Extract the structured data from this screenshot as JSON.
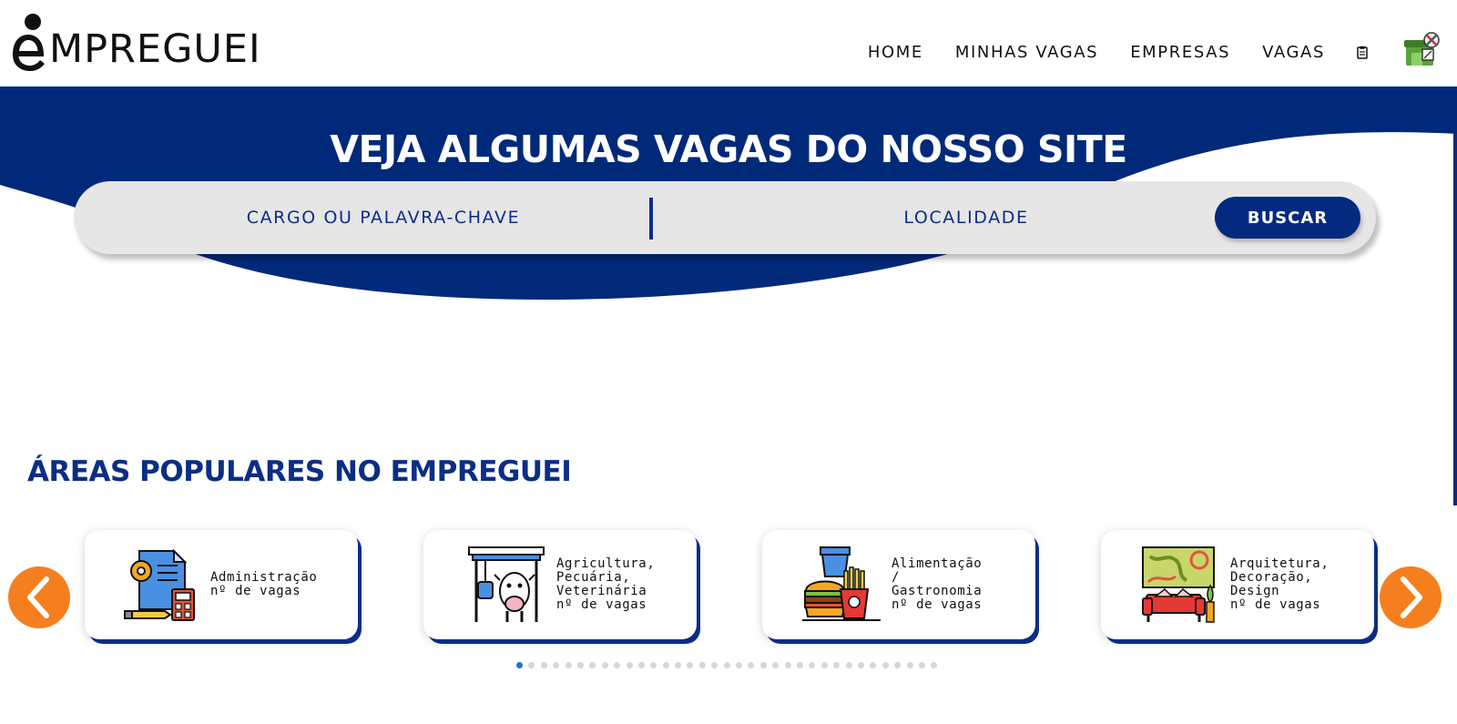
{
  "brand": {
    "logo_text": "MPREGUEI"
  },
  "nav": {
    "items": [
      "HOME",
      "MINHAS VAGAS",
      "EMPRESAS",
      "VAGAS"
    ],
    "clipboard_icon": "clipboard-icon",
    "avatar_icon": "profile-shop-icon"
  },
  "hero": {
    "title": "VEJA ALGUMAS VAGAS DO NOSSO SITE",
    "search": {
      "cargo_placeholder": "CARGO OU PALAVRA-CHAVE",
      "local_placeholder": "LOCALIDADE",
      "button_label": "BUSCAR"
    }
  },
  "section": {
    "title": "ÁREAS POPULARES NO EMPREGUEI"
  },
  "carousel": {
    "cards": [
      {
        "category": "Administração",
        "count_label": "nº de vagas",
        "icon": "admin-document-gear-icon"
      },
      {
        "category": "Agricultura,\nPecuária,\nVeterinária",
        "count_label": "nº de vagas",
        "icon": "livestock-cow-icon"
      },
      {
        "category": "Alimentação\n/\nGastronomia",
        "count_label": "nº de vagas",
        "icon": "food-burger-fries-icon"
      },
      {
        "category": "Arquitetura,\nDecoração,\nDesign",
        "count_label": "nº de vagas",
        "icon": "interior-sofa-icon"
      }
    ],
    "page_count": 35,
    "active_page": 1
  },
  "colors": {
    "primary": "#042a80",
    "accent": "#f57f1f",
    "dot_active": "#1976d2",
    "dot_inactive": "#d6d6d6",
    "search_bg": "#e6e6e6"
  }
}
